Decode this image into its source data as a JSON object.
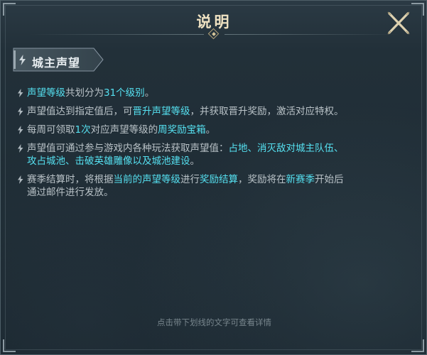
{
  "dialog": {
    "title": "说明",
    "close_icon": "close-x-icon"
  },
  "section": {
    "label": "城主声望",
    "icon": "lightning-icon"
  },
  "items": [
    {
      "segments": [
        {
          "text": "声望等级",
          "hl": true
        },
        {
          "text": "共划分为",
          "hl": false
        },
        {
          "text": "31个级别",
          "hl": true
        },
        {
          "text": "。",
          "hl": false
        }
      ]
    },
    {
      "segments": [
        {
          "text": "声望值达到指定值后，可",
          "hl": false
        },
        {
          "text": "晋升声望等级",
          "hl": true
        },
        {
          "text": "，并获取晋升奖励，激活对应特权。",
          "hl": false
        }
      ]
    },
    {
      "segments": [
        {
          "text": "每周可领取",
          "hl": false
        },
        {
          "text": "1次",
          "hl": true
        },
        {
          "text": "对应声望等级的",
          "hl": false
        },
        {
          "text": "周奖励宝箱",
          "hl": true
        },
        {
          "text": "。",
          "hl": false
        }
      ]
    },
    {
      "segments": [
        {
          "text": "声望值可通过参与游戏内各种玩法获取声望值：",
          "hl": false
        },
        {
          "text": "占地、消灭敌对城主队伍、",
          "hl": true
        },
        {
          "text": "\n",
          "hl": false
        },
        {
          "text": "攻占城池、击破英雄雕像以及城池建设",
          "hl": true
        },
        {
          "text": "。",
          "hl": false
        }
      ]
    },
    {
      "segments": [
        {
          "text": "赛季结算时，将根据",
          "hl": false
        },
        {
          "text": "当前的声望等级",
          "hl": true
        },
        {
          "text": "进行",
          "hl": false
        },
        {
          "text": "奖励结算",
          "hl": true
        },
        {
          "text": "，奖励将在",
          "hl": false
        },
        {
          "text": "新赛季",
          "hl": true
        },
        {
          "text": "开始后",
          "hl": false
        },
        {
          "text": "\n",
          "hl": false
        },
        {
          "text": "通过邮件进行发放。",
          "hl": false
        }
      ]
    }
  ],
  "footer": {
    "hint": "点击带下划线的文字可查看详情"
  },
  "colors": {
    "highlight": "#55e0f0",
    "body_text": "#b9c2c7",
    "title": "#efe2c2",
    "tag_bg": "#3a4a54"
  }
}
